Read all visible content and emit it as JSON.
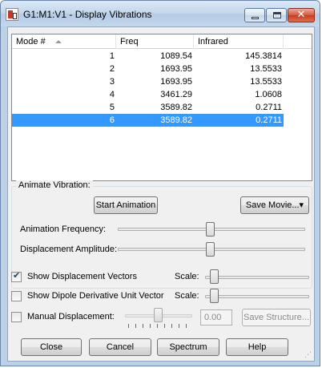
{
  "window": {
    "title": "G1:M1:V1 - Display Vibrations",
    "close_glyph": "✕"
  },
  "list": {
    "headers": {
      "mode": "Mode #",
      "freq": "Freq",
      "infrared": "Infrared"
    },
    "sorted_column": "mode",
    "rows": [
      {
        "mode": "1",
        "freq": "1089.54",
        "infrared": "145.3814"
      },
      {
        "mode": "2",
        "freq": "1693.95",
        "infrared": "13.5533"
      },
      {
        "mode": "3",
        "freq": "1693.95",
        "infrared": "13.5533"
      },
      {
        "mode": "4",
        "freq": "3461.29",
        "infrared": "1.0608"
      },
      {
        "mode": "5",
        "freq": "3589.82",
        "infrared": "0.2711"
      },
      {
        "mode": "6",
        "freq": "3589.82",
        "infrared": "0.2711"
      }
    ],
    "selected_index": 5
  },
  "animate": {
    "group_label": "Animate Vibration:",
    "start_button": "Start Animation",
    "save_movie_button": "Save Movie...",
    "save_movie_arrow": "▾",
    "frequency_label": "Animation Frequency:",
    "amplitude_label": "Displacement Amplitude:"
  },
  "options": {
    "show_displacement_vectors": {
      "label": "Show Displacement Vectors",
      "checked": true,
      "scale_label": "Scale:"
    },
    "show_dipole_vector": {
      "label": "Show Dipole Derivative Unit Vector",
      "checked": false,
      "scale_label": "Scale:"
    },
    "manual_displacement": {
      "label": "Manual Displacement:",
      "checked": false,
      "value": "0.00",
      "save_structure_button": "Save Structure..."
    }
  },
  "footer": {
    "close_button": "Close",
    "cancel_button": "Cancel",
    "spectrum_button": "Spectrum",
    "help_button": "Help"
  },
  "colors": {
    "selection": "#3399ff",
    "title_bar": "#c2d6ec",
    "close_button": "#d7573d"
  }
}
